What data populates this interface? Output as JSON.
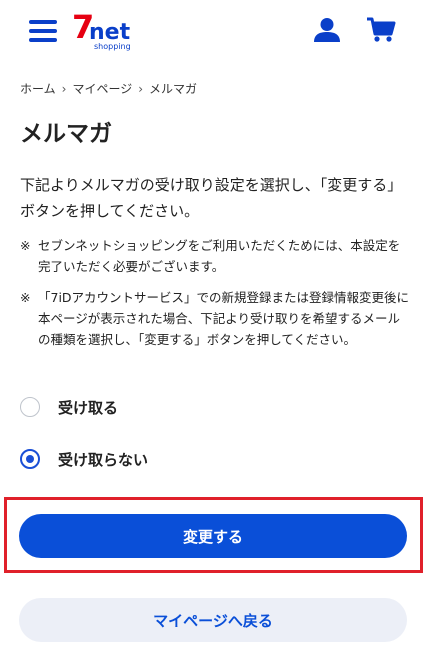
{
  "header": {
    "logo": {
      "top": "7",
      "bottom": "net",
      "sub": "shopping"
    },
    "icons": [
      "menu-icon",
      "user-icon",
      "cart-icon"
    ],
    "accent_color": "#0a3fc9",
    "logo_red": "#e60012"
  },
  "breadcrumb": [
    "ホーム",
    "マイページ",
    "メルマガ"
  ],
  "title": "メルマガ",
  "description": "下記よりメルマガの受け取り設定を選択し、「変更する」ボタンを押してください。",
  "notes": [
    {
      "mark": "※",
      "text": "セブンネットショッピングをご利用いただくためには、本設定を完了いただく必要がございます。"
    },
    {
      "mark": "※",
      "text": "「7iDアカウントサービス」での新規登録または登録情報変更後に本ページが表示された場合、下記より受け取りを希望するメールの種類を選択し、「変更する」ボタンを押してください。"
    }
  ],
  "options": [
    {
      "label": "受け取る",
      "checked": false
    },
    {
      "label": "受け取らない",
      "checked": true
    }
  ],
  "buttons": {
    "submit": "変更する",
    "back": "マイページへ戻る"
  },
  "colors": {
    "primary": "#0a4fd8",
    "highlight_border": "#e0202a",
    "secondary_bg": "#eceff7"
  }
}
